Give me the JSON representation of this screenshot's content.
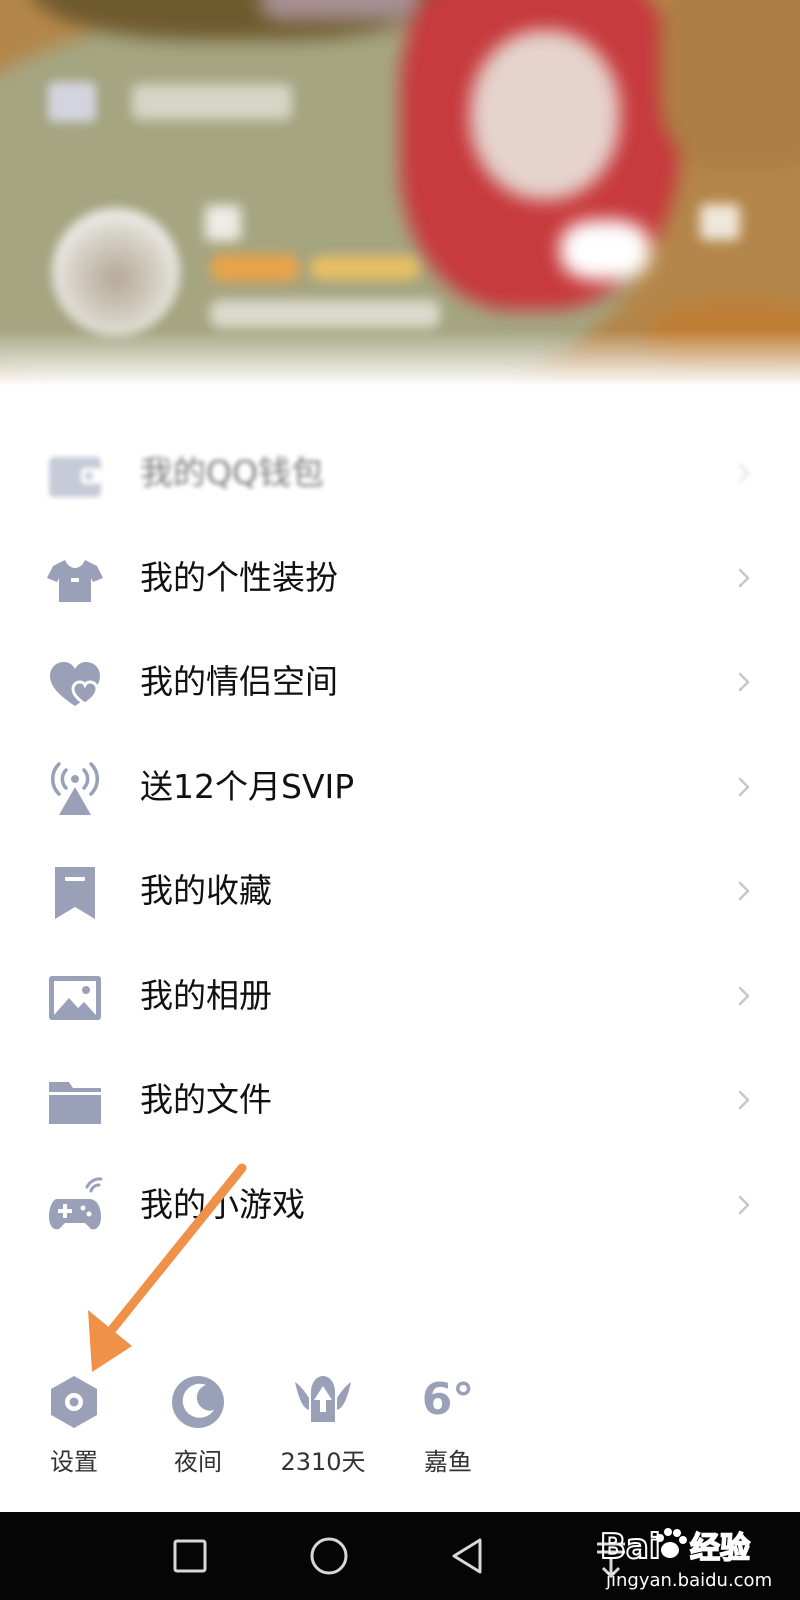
{
  "menu": {
    "items": [
      {
        "label": "我的QQ钱包",
        "icon": "wallet-icon"
      },
      {
        "label": "我的个性装扮",
        "icon": "tshirt-icon"
      },
      {
        "label": "我的情侣空间",
        "icon": "hearts-icon"
      },
      {
        "label": "送12个月SVIP",
        "icon": "broadcast-tower-icon"
      },
      {
        "label": "我的收藏",
        "icon": "bookmark-icon"
      },
      {
        "label": "我的相册",
        "icon": "picture-icon"
      },
      {
        "label": "我的文件",
        "icon": "folder-icon"
      },
      {
        "label": "我的小游戏",
        "icon": "gamepad-icon"
      }
    ]
  },
  "toolbar": {
    "settings_label": "设置",
    "night_label": "夜间",
    "days_label": "2310天",
    "weather_temp": "6°",
    "weather_city": "嘉鱼"
  },
  "watermark": {
    "brand": "Bai 经验",
    "url": "jingyan.baidu.com"
  },
  "colors": {
    "icon": "#9aa0b8",
    "text": "#111111",
    "chevron": "#c4c6cf",
    "arrow": "#f0914a",
    "nav_bar": "#050505"
  }
}
